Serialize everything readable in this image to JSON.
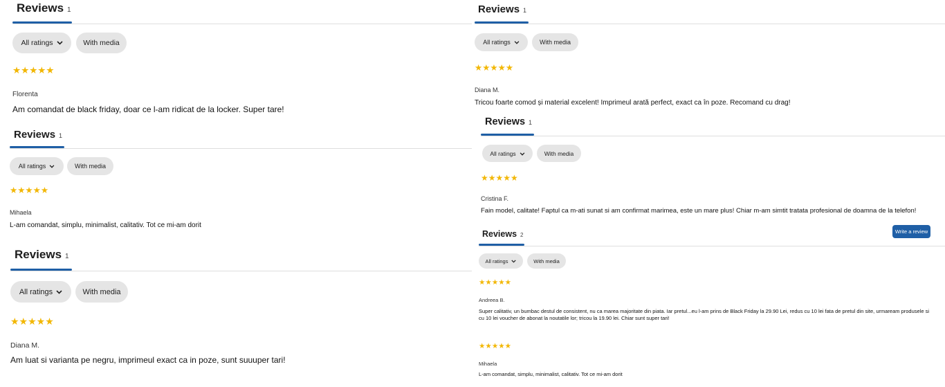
{
  "common": {
    "heading": "Reviews",
    "all_ratings": "All ratings",
    "with_media": "With media",
    "stars": "★★★★★",
    "accent": "#1f5fa6",
    "star_color": "#f2b705"
  },
  "widgets": [
    {
      "count": "1",
      "reviews": [
        {
          "rating": 5,
          "author": "Florenta",
          "text": "Am comandat de black friday, doar ce l-am ridicat de la locker. Super tare!"
        }
      ]
    },
    {
      "count": "1",
      "reviews": [
        {
          "rating": 5,
          "author": "Mihaela",
          "text": "L-am comandat, simplu, minimalist, calitativ. Tot ce mi-am dorit"
        }
      ]
    },
    {
      "count": "1",
      "reviews": [
        {
          "rating": 5,
          "author": "Diana M.",
          "text": "Am luat si varianta pe negru, imprimeul exact ca in poze, sunt suuuper tari!"
        }
      ]
    },
    {
      "count": "1",
      "reviews": [
        {
          "rating": 5,
          "author": "Diana M.",
          "text": "Tricou foarte comod și material excelent! Imprimeul arată perfect, exact ca în poze. Recomand cu drag!"
        }
      ]
    },
    {
      "count": "1",
      "reviews": [
        {
          "rating": 5,
          "author": "Cristina F.",
          "text": "Fain model, calitate! Faptul ca m-ati sunat si am confirmat marimea, este un mare plus! Chiar m-am simtit tratata profesional de doamna de la telefon!"
        }
      ]
    },
    {
      "count": "2",
      "write_review": "Write a review",
      "reviews": [
        {
          "rating": 5,
          "author": "Andreea B.",
          "text": "Super calitativ, un bumbac destul de consistent, nu ca marea majoritate din piata. Iar pretul...eu l-am prins de Black Friday la 29.90 Lei, redus cu 10 lei fata de pretul din site, urmaream produsele si cu 10 lei voucher de abonat la noutatile lor; tricou la 19.90 lei. Chiar sunt super tari!"
        },
        {
          "rating": 5,
          "author": "Mihaela",
          "text": "L-am comandat, simplu, minimalist, calitativ. Tot ce mi-am dorit"
        }
      ]
    }
  ]
}
